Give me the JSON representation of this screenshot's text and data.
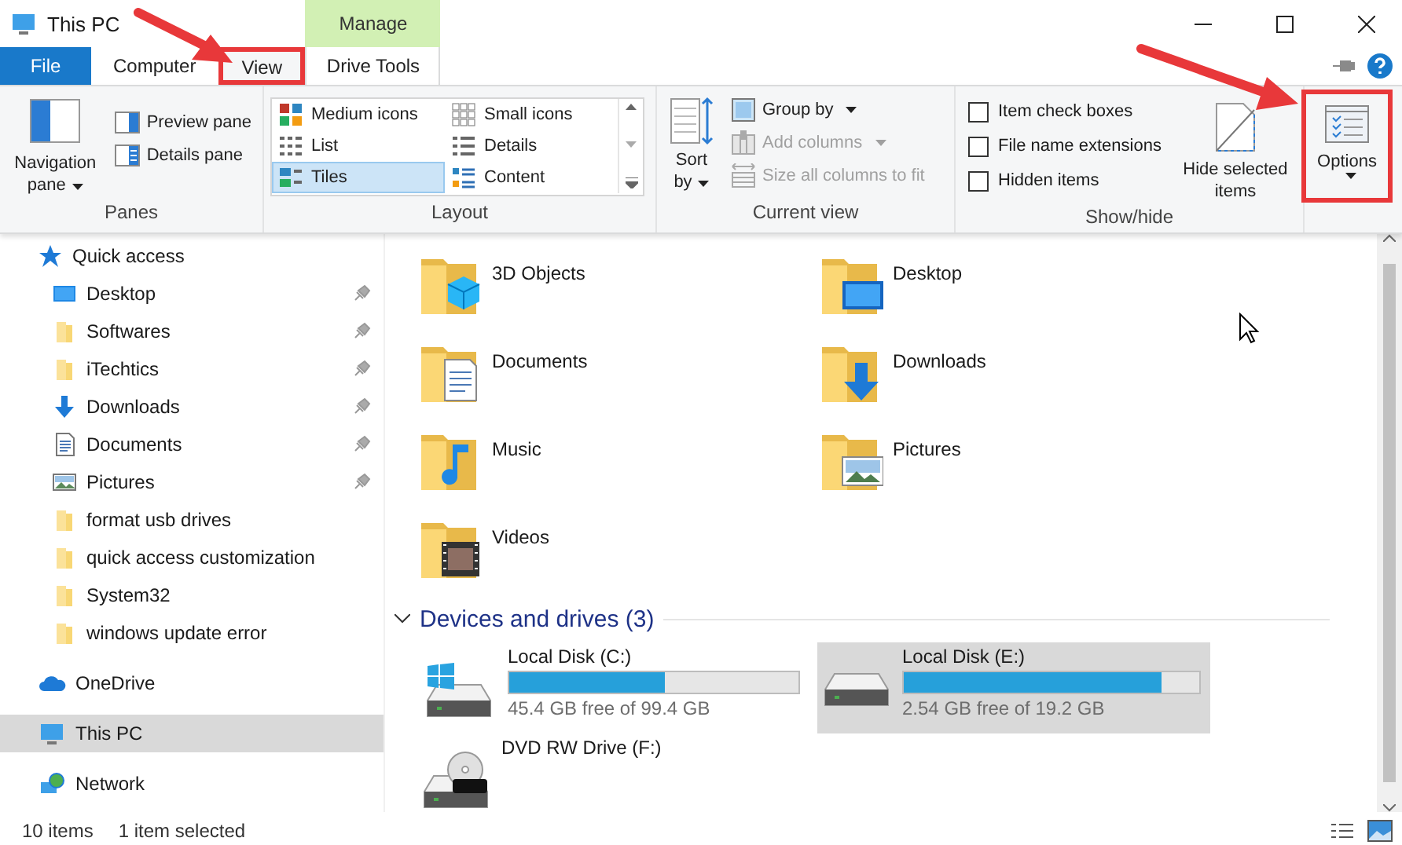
{
  "window": {
    "title": "This PC"
  },
  "ribbon": {
    "tabs": [
      {
        "label": "File",
        "kind": "file",
        "selected": false,
        "highlighted": false
      },
      {
        "label": "Computer",
        "kind": "tab",
        "selected": false,
        "highlighted": false
      },
      {
        "label": "View",
        "kind": "tab",
        "selected": true,
        "highlighted": true
      },
      {
        "label": "Drive Tools",
        "kind": "contextual",
        "context": "Manage",
        "selected": false,
        "highlighted": false
      }
    ],
    "panes": {
      "label": "Panes",
      "navigation_pane": "Navigation pane",
      "items": [
        "Preview pane",
        "Details pane"
      ]
    },
    "layout": {
      "label": "Layout",
      "options": [
        {
          "label": "Medium icons",
          "selected": false
        },
        {
          "label": "Small icons",
          "selected": false
        },
        {
          "label": "List",
          "selected": false
        },
        {
          "label": "Details",
          "selected": false
        },
        {
          "label": "Tiles",
          "selected": true
        },
        {
          "label": "Content",
          "selected": false
        }
      ]
    },
    "current_view": {
      "label": "Current view",
      "sort": "Sort by",
      "commands": [
        {
          "label": "Group by",
          "disabled": false
        },
        {
          "label": "Add columns",
          "disabled": true
        },
        {
          "label": "Size all columns to fit",
          "disabled": true
        }
      ]
    },
    "show_hide": {
      "label": "Show/hide",
      "checkboxes": [
        {
          "label": "Item check boxes",
          "checked": false
        },
        {
          "label": "File name extensions",
          "checked": false
        },
        {
          "label": "Hidden items",
          "checked": false
        }
      ],
      "hide_selected": "Hide selected items"
    },
    "options": {
      "label": "Options",
      "highlighted": true
    }
  },
  "navigation": {
    "quick_access": {
      "label": "Quick access",
      "items": [
        {
          "name": "Desktop",
          "kind": "desktop",
          "pinned": true
        },
        {
          "name": "Softwares",
          "kind": "folder",
          "pinned": true
        },
        {
          "name": "iTechtics",
          "kind": "folder",
          "pinned": true
        },
        {
          "name": "Downloads",
          "kind": "downloads",
          "pinned": true
        },
        {
          "name": "Documents",
          "kind": "documents",
          "pinned": true
        },
        {
          "name": "Pictures",
          "kind": "pictures",
          "pinned": true
        },
        {
          "name": "format usb drives",
          "kind": "folder",
          "pinned": false
        },
        {
          "name": "quick access customization",
          "kind": "folder",
          "pinned": false
        },
        {
          "name": "System32",
          "kind": "folder",
          "pinned": false
        },
        {
          "name": "windows update error",
          "kind": "folder",
          "pinned": false
        }
      ]
    },
    "locations": [
      {
        "name": "OneDrive",
        "kind": "cloud",
        "selected": false
      },
      {
        "name": "This PC",
        "kind": "pc",
        "selected": true
      },
      {
        "name": "Network",
        "kind": "network",
        "selected": false
      }
    ]
  },
  "content": {
    "folders": [
      {
        "name": "3D Objects",
        "kind": "objects"
      },
      {
        "name": "Desktop",
        "kind": "desktop"
      },
      {
        "name": "Documents",
        "kind": "documents"
      },
      {
        "name": "Downloads",
        "kind": "downloads"
      },
      {
        "name": "Music",
        "kind": "music"
      },
      {
        "name": "Pictures",
        "kind": "pictures"
      },
      {
        "name": "Videos",
        "kind": "videos"
      }
    ],
    "devices": {
      "title": "Devices and drives (3)",
      "expanded": true,
      "drives": [
        {
          "name": "Local Disk (C:)",
          "kind": "system",
          "level": 0.54,
          "free": "45.4 GB free of 99.4 GB",
          "selected": false
        },
        {
          "name": "Local Disk (E:)",
          "kind": "disk",
          "level": 0.87,
          "free": "2.54 GB free of 19.2 GB",
          "selected": true
        },
        {
          "name": "DVD RW Drive (F:)",
          "kind": "dvd",
          "selected": false
        }
      ]
    }
  },
  "status_bar": {
    "item_count": "10 items",
    "selection": "1 item selected"
  }
}
